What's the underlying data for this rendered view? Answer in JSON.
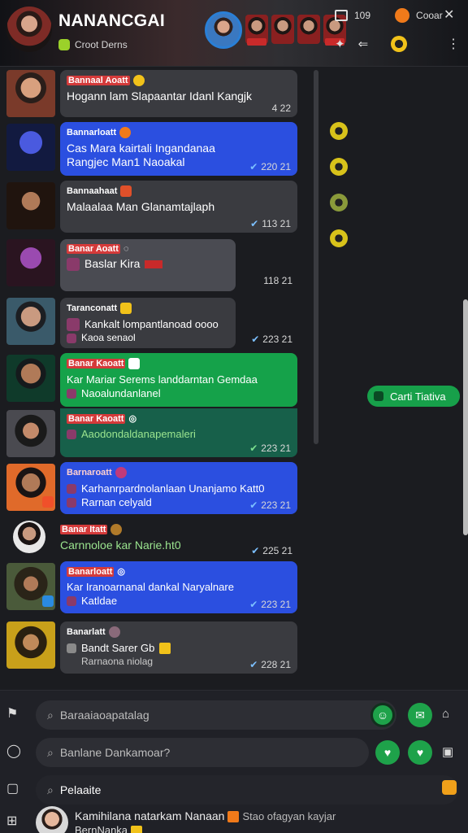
{
  "header": {
    "title": "NANANCGAI",
    "subtitle": "Croot Derns",
    "status_count": "109",
    "status_label": "Cooar"
  },
  "messages": [
    {
      "sender": "Bannaal Aoatt",
      "text": "Hogann lam Slapaantar Idanl Kangjk",
      "meta": "4 22",
      "style": "dark"
    },
    {
      "sender": "Bannarloatt",
      "text": "Cas Mara kairtali Ingandanaa",
      "text2": "Rangjec Man1 Naoakal",
      "meta": "220 21",
      "style": "blue"
    },
    {
      "sender": "Bannaahaat",
      "text": "Malaalaa Man Glanamtajlaph",
      "meta": "113 21",
      "style": "dark"
    },
    {
      "sender": "Banar Aoatt",
      "text": "Baslar Kira",
      "meta": "118 21",
      "style": "gray"
    },
    {
      "sender": "Taranconatt",
      "text": "Kankalt lompantlanoad oooo",
      "text2": "Kaoa senaol",
      "meta": "223 21",
      "style": "dark"
    },
    {
      "sender": "Banar Kaoatt",
      "text": "Kar Mariar Serems landdarntan Gemdaa",
      "text2": "Naoalundanlanel",
      "meta": "",
      "style": "green"
    },
    {
      "sender": "Banar Kaoatt",
      "text": "Aaodondaldanapemaleri",
      "meta": "223 21",
      "style": "dgreen"
    },
    {
      "sender": "Barnaroatt",
      "text": "Karhanrpardnolanlaan Unanjamo Katt0",
      "text2": "Rarnan celyald",
      "meta": "223 21",
      "style": "blue"
    },
    {
      "sender": "Banar Itatt",
      "text": "Carnnoloe kar Narie.ht0",
      "meta": "225 21",
      "style": "plain"
    },
    {
      "sender": "Banarloatt",
      "text": "Kar Iranoarnanal dankal Naryalnare",
      "text2": "Katldae",
      "meta": "223 21",
      "style": "blue"
    },
    {
      "sender": "Banarlatt",
      "text": "Bandt Sarer Gb",
      "text2": "Rarnaona niolag",
      "meta": "228 21",
      "style": "dark"
    }
  ],
  "contact_pill": "Carti Tiativa",
  "composer": {
    "search1": "Baraaiaoapatalag",
    "search2": "Banlane Dankamoar?",
    "search3": "Pelaaite"
  },
  "user": {
    "line1": "Kamihilana natarkam Nanaan",
    "line1b": "Stao ofagyan kayjar",
    "line2": "BernNanka"
  }
}
